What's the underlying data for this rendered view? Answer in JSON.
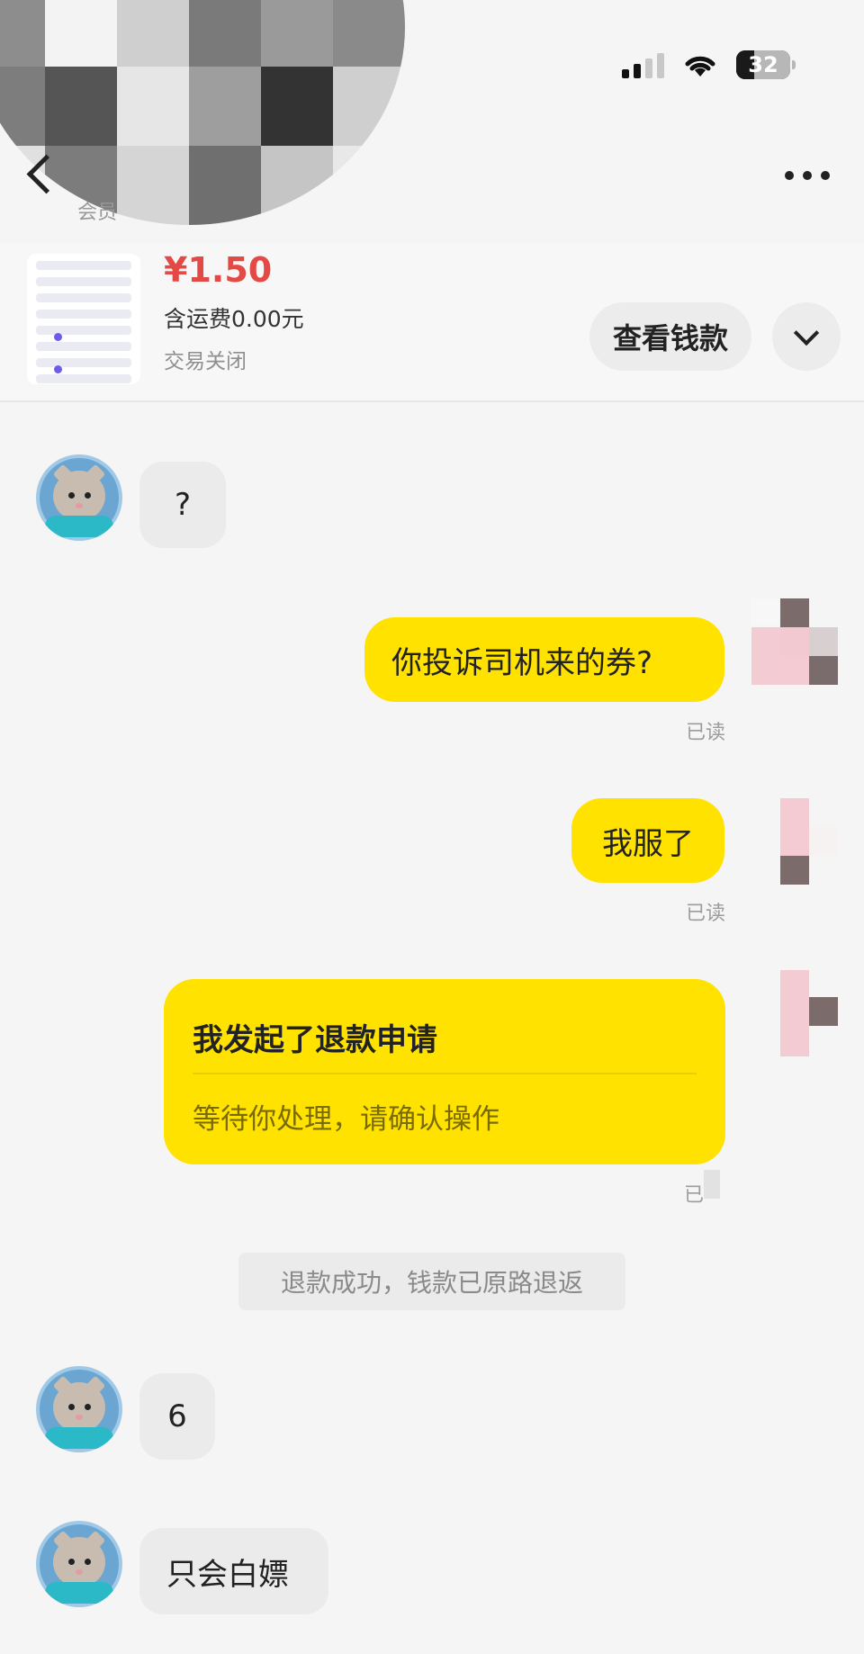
{
  "status_bar": {
    "battery": "32"
  },
  "header": {
    "subtitle_partial": "会员"
  },
  "product": {
    "price": "¥1.50",
    "shipping": "含运费0.00元",
    "status": "交易关闭",
    "view_funds_label": "查看钱款"
  },
  "messages": {
    "m1": "?",
    "m2": "你投诉司机来的券?",
    "m2_read": "已读",
    "m3": "我服了",
    "m3_read": "已读",
    "refund_title": "我发起了退款申请",
    "refund_sub": "等待你处理，请确认操作",
    "refund_read": "已",
    "system_note": "退款成功，钱款已原路退返",
    "m5": "6",
    "m6": "只会白嫖"
  },
  "colors": {
    "accent_yellow": "#ffe200",
    "price_red": "#e34a45"
  }
}
